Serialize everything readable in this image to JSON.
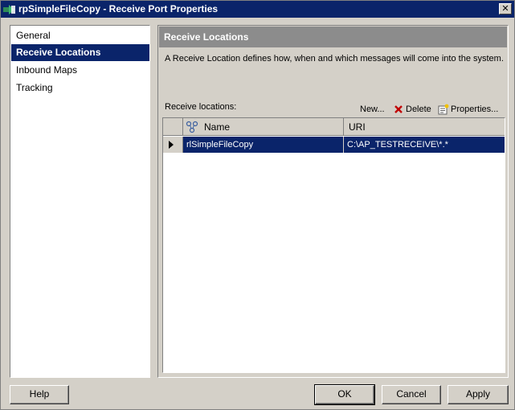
{
  "window": {
    "title": "rpSimpleFileCopy - Receive Port Properties",
    "close_glyph": "✕"
  },
  "nav": {
    "items": [
      {
        "label": "General",
        "selected": false
      },
      {
        "label": "Receive Locations",
        "selected": true
      },
      {
        "label": "Inbound Maps",
        "selected": false
      },
      {
        "label": "Tracking",
        "selected": false
      }
    ]
  },
  "main": {
    "header": "Receive Locations",
    "description": "A Receive Location defines how, when and which messages will come into the system.",
    "locations_label": "Receive locations:",
    "toolbar": {
      "new_label": "New...",
      "delete_label": "Delete",
      "properties_label": "Properties..."
    },
    "grid": {
      "columns": {
        "name": "Name",
        "uri": "URI"
      },
      "rows": [
        {
          "name": "rlSimpleFileCopy",
          "uri": "C:\\AP_TESTRECEIVE\\*.*",
          "selected": true
        }
      ]
    }
  },
  "buttons": {
    "help": "Help",
    "ok": "OK",
    "cancel": "Cancel",
    "apply": "Apply"
  },
  "colors": {
    "selection": "#0a246a",
    "header_bar": "#8c8c8c",
    "dialog_bg": "#d4d0c8",
    "delete_icon": "#c00000"
  },
  "icons": {
    "title": "port-arrow-icon",
    "delete": "red-x-icon",
    "properties": "properties-icon",
    "column_header": "receive-location-icon"
  }
}
